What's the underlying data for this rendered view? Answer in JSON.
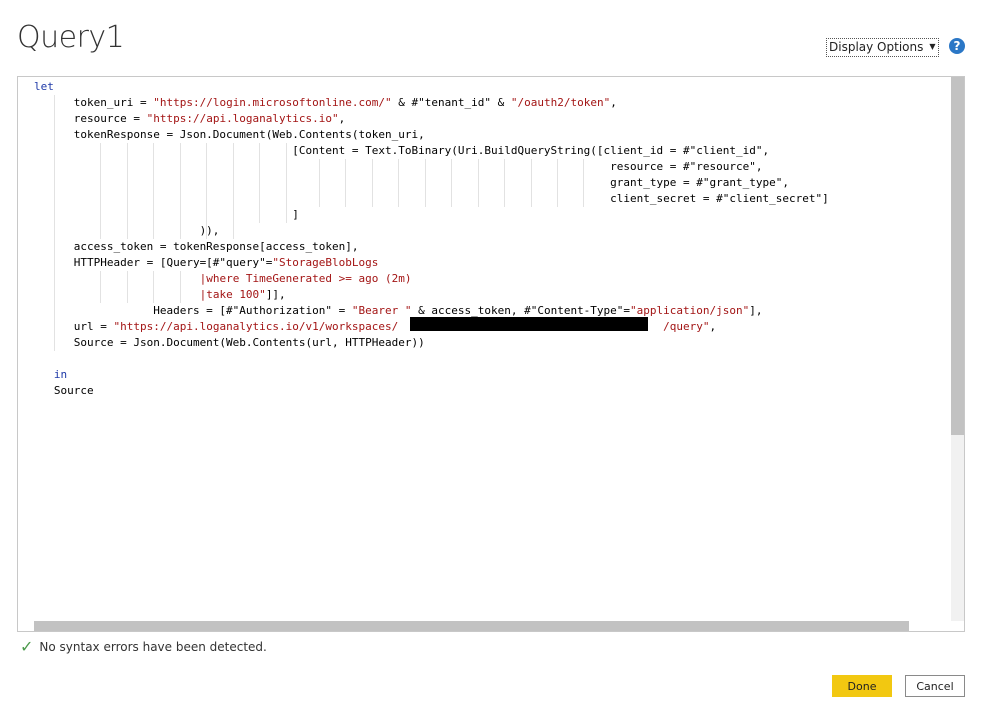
{
  "header": {
    "title": "Query1",
    "display_options": "Display Options",
    "help_icon": "?"
  },
  "code_lines": [
    [
      [
        "kw",
        "let"
      ]
    ],
    [
      [
        "t",
        "      token_uri = "
      ],
      [
        "str",
        "\"https://login.microsoftonline.com/\""
      ],
      [
        "t",
        " & #\"tenant_id\" & "
      ],
      [
        "str",
        "\"/oauth2/token\""
      ],
      [
        "t",
        ","
      ]
    ],
    [
      [
        "t",
        "      resource = "
      ],
      [
        "str",
        "\"https://api.loganalytics.io\""
      ],
      [
        "t",
        ","
      ]
    ],
    [
      [
        "t",
        "      tokenResponse = Json.Document(Web.Contents(token_uri,"
      ]
    ],
    [
      [
        "t",
        "                                       [Content = Text.ToBinary(Uri.BuildQueryString([client_id = #\"client_id\","
      ]
    ],
    [
      [
        "t",
        "                                                                                       resource = #\"resource\","
      ]
    ],
    [
      [
        "t",
        "                                                                                       grant_type = #\"grant_type\","
      ]
    ],
    [
      [
        "t",
        "                                                                                       client_secret = #\"client_secret\"]"
      ]
    ],
    [
      [
        "t",
        "                                       ]"
      ]
    ],
    [
      [
        "t",
        "                         )),"
      ]
    ],
    [
      [
        "t",
        "      access_token = tokenResponse[access_token],"
      ]
    ],
    [
      [
        "t",
        "      HTTPHeader = [Query=[#\"query\"="
      ],
      [
        "str",
        "\"StorageBlobLogs"
      ]
    ],
    [
      [
        "t",
        "                         "
      ],
      [
        "str",
        "|where TimeGenerated >= ago (2m)"
      ]
    ],
    [
      [
        "t",
        "                         "
      ],
      [
        "str",
        "|take 100\""
      ],
      [
        "t",
        "]],"
      ]
    ],
    [
      [
        "t",
        "                  Headers = [#\"Authorization\" = "
      ],
      [
        "str",
        "\"Bearer \""
      ],
      [
        "t",
        " & access_token, #\"Content-Type\"="
      ],
      [
        "str",
        "\"application/json\""
      ],
      [
        "t",
        "],"
      ]
    ],
    [
      [
        "t",
        "      url = "
      ],
      [
        "str",
        "\"https://api.loganalytics.io/v1/workspaces/"
      ],
      [
        "t",
        "                                        "
      ],
      [
        "str",
        "/query\""
      ],
      [
        "t",
        ","
      ]
    ],
    [
      [
        "t",
        "      Source = Json.Document(Web.Contents(url, HTTPHeader))"
      ]
    ],
    [
      [
        "t",
        ""
      ]
    ],
    [
      [
        "t",
        "   "
      ],
      [
        "kw",
        "in"
      ]
    ],
    [
      [
        "t",
        "   Source"
      ]
    ]
  ],
  "status": {
    "message": "No syntax errors have been detected."
  },
  "buttons": {
    "done": "Done",
    "cancel": "Cancel"
  }
}
